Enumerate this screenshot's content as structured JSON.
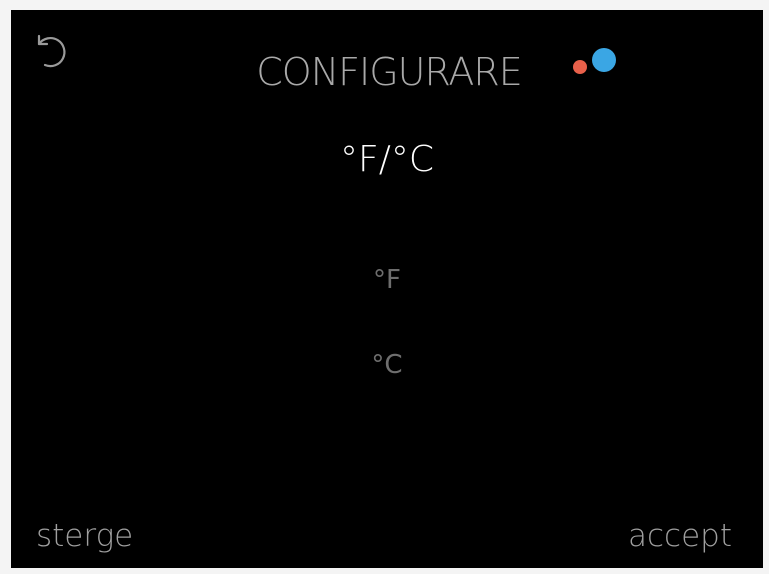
{
  "header": {
    "back_icon": "undo-arrow-icon",
    "title": "CONFIGURARE",
    "indicator": {
      "dot_colors": [
        "#e8604a",
        "#3aa6e4"
      ]
    }
  },
  "setting": {
    "name": "°F/°C",
    "options": [
      "°F",
      "°C"
    ]
  },
  "footer": {
    "clear_label": "sterge",
    "accept_label": "accept"
  },
  "colors": {
    "background": "#000000",
    "title": "#a9a9a9",
    "subtitle": "#ffffff",
    "option": "#6e6e6e",
    "footer": "#a0a0a0"
  }
}
